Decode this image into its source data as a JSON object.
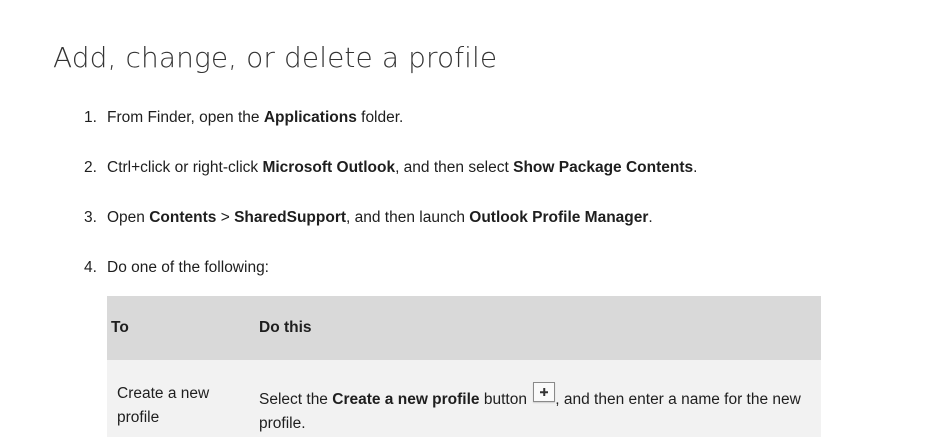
{
  "title": "Add, change, or delete a profile",
  "steps": [
    {
      "num": "1.",
      "parts": [
        "From Finder, open the ",
        "Applications",
        " folder."
      ]
    },
    {
      "num": "2.",
      "parts": [
        "Ctrl+click or right-click ",
        "Microsoft Outlook",
        ", and then select ",
        "Show Package Contents",
        "."
      ]
    },
    {
      "num": "3.",
      "parts": [
        "Open ",
        "Contents",
        " > ",
        "SharedSupport",
        ", and then launch ",
        "Outlook Profile Manager",
        "."
      ]
    },
    {
      "num": "4.",
      "parts": [
        "Do one of the following:"
      ]
    }
  ],
  "table": {
    "headers": [
      "To",
      "Do this"
    ],
    "rows": [
      {
        "to": "Create a new profile",
        "do_pre": "Select the ",
        "do_bold": "Create a new profile",
        "do_mid": " button ",
        "button_icon": "plus-icon",
        "do_post": ", and then enter a name for the new profile."
      }
    ]
  }
}
